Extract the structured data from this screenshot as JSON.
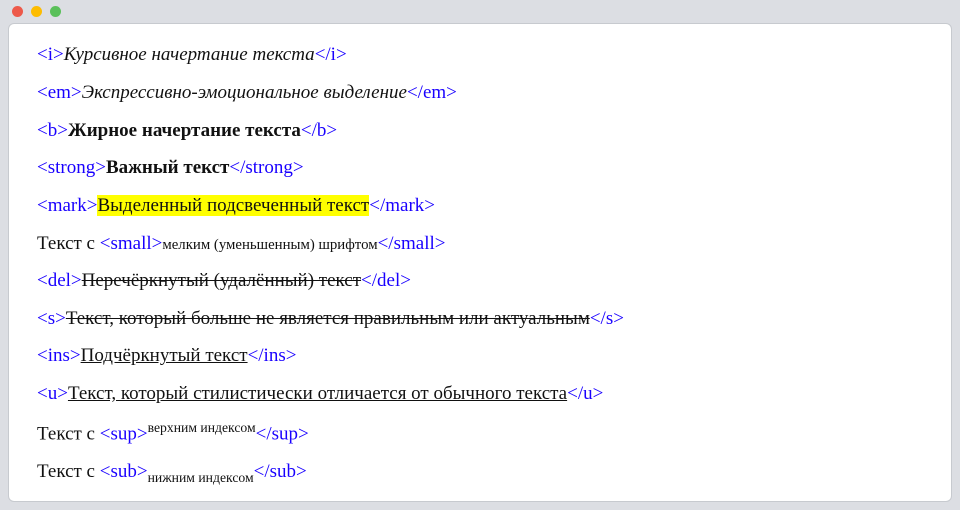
{
  "rows": [
    {
      "open": "<i>",
      "close": "</i>",
      "prefix": "",
      "styled": "Курсивное начертание текста",
      "style": "italic"
    },
    {
      "open": "<em>",
      "close": "</em>",
      "prefix": "",
      "styled": "Экспрессивно-эмоциональное выделение",
      "style": "italic"
    },
    {
      "open": "<b>",
      "close": "</b>",
      "prefix": "",
      "styled": "Жирное начертание текста",
      "style": "bold"
    },
    {
      "open": "<strong>",
      "close": "</strong>",
      "prefix": "",
      "styled": "Важный текст",
      "style": "bold"
    },
    {
      "open": "<mark>",
      "close": "</mark>",
      "prefix": "",
      "styled": "Выделенный подсвеченный текст",
      "style": "mark"
    },
    {
      "open": "<small>",
      "close": "</small>",
      "prefix": "Текст с ",
      "styled": "мелким (уменьшенным) шрифтом",
      "style": "small"
    },
    {
      "open": "<del>",
      "close": "</del>",
      "prefix": "",
      "styled": "Перечёркнутый (удалённый) текст",
      "style": "del"
    },
    {
      "open": "<s>",
      "close": "</s>",
      "prefix": "",
      "styled": "Текст, который больше не является правильным или актуальным",
      "style": "del"
    },
    {
      "open": "<ins>",
      "close": "</ins>",
      "prefix": "",
      "styled": "Подчёркнутый текст",
      "style": "ins"
    },
    {
      "open": "<u>",
      "close": "</u>",
      "prefix": "",
      "styled": "Текст, который стилистически отличается от обычного текста",
      "style": "u"
    },
    {
      "open": "<sup>",
      "close": "</sup>",
      "prefix": "Текст с ",
      "styled": "верхним индексом",
      "style": "sup"
    },
    {
      "open": "<sub>",
      "close": "</sub>",
      "prefix": "Текст с ",
      "styled": "нижним индексом",
      "style": "sub"
    }
  ]
}
